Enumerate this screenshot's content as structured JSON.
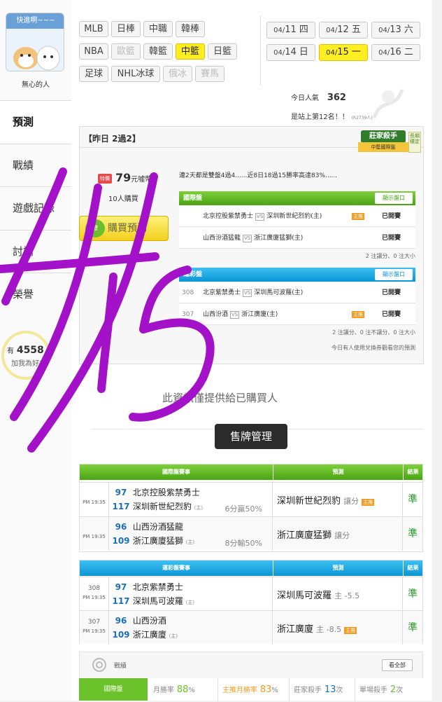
{
  "user": {
    "avatar_caption": "快進啊~~~",
    "name": "無心的人"
  },
  "side_nav": [
    {
      "label": "預測",
      "active": true
    },
    {
      "label": "戰績"
    },
    {
      "label": "遊戲記錄"
    },
    {
      "label": "討論"
    },
    {
      "label": "榮譽"
    }
  ],
  "fans": {
    "prefix": "有",
    "count": "4558",
    "label": "加我為好友"
  },
  "sports": [
    {
      "label": "MLB"
    },
    {
      "label": "日棒"
    },
    {
      "label": "中職"
    },
    {
      "label": "韓棒"
    },
    {
      "label": "NBA",
      "state": "dim"
    },
    {
      "label": "歐籃",
      "state": "dim"
    },
    {
      "label": "韓籃"
    },
    {
      "label": "中籃",
      "state": "on"
    },
    {
      "label": "日籃"
    },
    {
      "label": "足球"
    },
    {
      "label": "NHL冰球"
    },
    {
      "label": "俄冰",
      "state": "dim"
    },
    {
      "label": "賽馬",
      "state": "dim"
    }
  ],
  "dates": [
    {
      "md": "04/",
      "d": "11",
      "w": "四"
    },
    {
      "md": "04/",
      "d": "12",
      "w": "五"
    },
    {
      "md": "04/",
      "d": "13",
      "w": "六"
    },
    {
      "md": "04/",
      "d": "14",
      "w": "日"
    },
    {
      "md": "04/",
      "d": "15",
      "w": "一",
      "on": true
    },
    {
      "md": "04/",
      "d": "16",
      "w": "二"
    }
  ],
  "popularity": {
    "label": "今日人氣",
    "value": "362",
    "rank_text": "是站上第12名！！",
    "rank_small": "(R2739人)"
  },
  "badge": {
    "main": "莊家殺手",
    "sub": "中籃國際盤",
    "side": "長期穩定"
  },
  "yesterday": "【昨日 2過2】",
  "offer": {
    "tag": "特價",
    "price": "79",
    "unit": "元噓幣",
    "buyers": "10人購買",
    "buy_label": "購買預測",
    "note": "連2天都是雙盤4過4......近8日18過15勝率高達83%......"
  },
  "intl": {
    "title": "國際盤",
    "show_btn": "顯示盤口",
    "rows": [
      {
        "no": "",
        "away": "北京控股紫禁勇士",
        "home": "深圳新世紀烈豹(主)",
        "tag": "主推",
        "status": "已開賽"
      },
      {
        "no": "",
        "away": "山西汾酒猛龍",
        "home": "浙江廣廈猛獅(主)",
        "tag": "",
        "status": "已開賽"
      }
    ],
    "summary": "2 注讓分、0 注大小"
  },
  "lottery": {
    "title": "運彩盤",
    "show_btn": "顯示盤口",
    "rows": [
      {
        "no": "308",
        "away": "北京紫禁勇士",
        "home": "深圳馬可波羅(主)",
        "tag": "",
        "status": "已開賽"
      },
      {
        "no": "307",
        "away": "山西汾酒",
        "home": "浙江廣廈(主)",
        "tag": "主推",
        "status": "已開賽"
      }
    ],
    "summary": "2 注讓分、0 注不讓分、0 注大小",
    "coupon_note": "今日有人使用兌換券觀看您的預測"
  },
  "info_note": "此資訊僅提供給已購買人",
  "manage_btn": "售牌管理",
  "intl_results": {
    "header": {
      "game": "國際盤賽事",
      "pred": "預測",
      "res": "結果"
    },
    "rows": [
      {
        "no": "",
        "time": "PM 19:35",
        "away_no": "97",
        "away": "北京控股紫禁勇士",
        "home_no": "117",
        "home": "深圳新世紀烈豹",
        "host": "(主)",
        "odds": "6分贏50%",
        "pick": "深圳新世紀烈豹",
        "pick_extra": "讓分",
        "pick_tag": "主推",
        "result": "準"
      },
      {
        "no": "",
        "time": "PM 19:35",
        "away_no": "96",
        "away": "山西汾酒猛龍",
        "home_no": "109",
        "home": "浙江廣廈猛獅",
        "host": "(主)",
        "odds": "8分輸50%",
        "pick": "浙江廣廈猛獅",
        "pick_extra": "讓分",
        "pick_tag": "",
        "result": "準"
      }
    ]
  },
  "lottery_results": {
    "header": {
      "game": "運彩盤賽事",
      "pred": "預測",
      "res": "結果"
    },
    "rows": [
      {
        "no": "308",
        "time": "PM 19:35",
        "away_no": "97",
        "away": "北京紫禁勇士",
        "home_no": "117",
        "home": "深圳馬可波羅",
        "host": "(主)",
        "odds": "",
        "pick": "深圳馬可波羅",
        "pick_extra": "主 -5.5",
        "pick_tag": "",
        "result": "準"
      },
      {
        "no": "307",
        "time": "PM 19:35",
        "away_no": "96",
        "away": "山西汾酒",
        "home_no": "109",
        "home": "浙江廣廈",
        "host": "(主)",
        "odds": "",
        "pick": "浙江廣廈",
        "pick_extra": "主 -8.5",
        "pick_tag": "主推",
        "result": "準"
      }
    ]
  },
  "record": {
    "title": "戰績",
    "view_all": "看全部",
    "tab": "國際盤",
    "stats": [
      {
        "label": "月勝率",
        "value": "88",
        "unit": "%"
      },
      {
        "label": "主推月勝率",
        "value": "83",
        "unit": "%"
      },
      {
        "label": "莊家殺手",
        "value": "13",
        "unit": "次"
      },
      {
        "label": "單場殺手",
        "value": "2",
        "unit": "次"
      }
    ]
  },
  "handwriting": "4/15",
  "colors": {
    "green": "#4aa414",
    "blue": "#0b95d6",
    "yellow": "#ffee22",
    "ink": "#a312c8"
  }
}
